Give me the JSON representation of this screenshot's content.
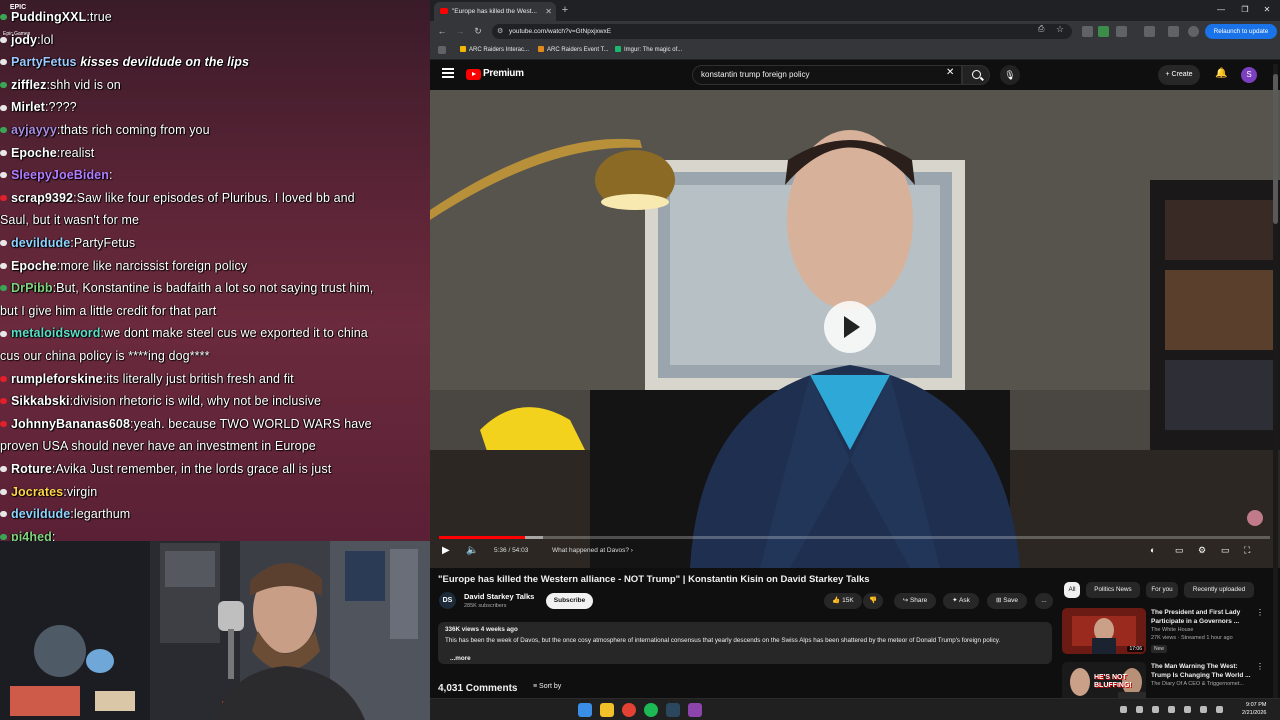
{
  "overlay": {
    "epic_label": "EPIC",
    "epic_sub": "Epic Games",
    "chat": [
      {
        "user": "PuddingXXL",
        "message": "true",
        "color": "#ffffff",
        "badge": "#3aa655",
        "italic": false
      },
      {
        "user": "jody",
        "message": "lol",
        "color": "#ffffff",
        "badge": "#e8e8e8",
        "italic": false
      },
      {
        "user": "PartyFetus",
        "message": "kisses devildude on the lips",
        "color": "#9ec9ff",
        "badge": "#e8e8e8",
        "italic": true
      },
      {
        "user": "zifflez",
        "message": "shh vid is on",
        "color": "#ffffff",
        "badge": "#3aa655",
        "italic": false
      },
      {
        "user": "Mirlet",
        "message": "????",
        "color": "#ffffff",
        "badge": "#e8e8e8",
        "italic": false
      },
      {
        "user": "ayjayyy",
        "message": "thats rich coming from you",
        "color": "#a98ce0",
        "badge": "#3aa655",
        "italic": false
      },
      {
        "user": "Epoche",
        "message": "realist",
        "color": "#ffffff",
        "badge": "#e8e8e8",
        "italic": false
      },
      {
        "user": "SleepyJoeBiden",
        "message": "",
        "color": "#b57cff",
        "badge": "#e8e8e8",
        "italic": false
      },
      {
        "user": "scrap9392",
        "message": "Saw like four episodes of Pluribus. I loved bb and",
        "color": "#ffffff",
        "badge": "#e0202a",
        "italic": false
      },
      {
        "user": "",
        "message": "Saul, but it wasn't for me",
        "color": "#ffffff",
        "badge": "",
        "italic": false
      },
      {
        "user": "devildude",
        "message": "PartyFetus",
        "color": "#8fd3ff",
        "badge": "#e8e8e8",
        "italic": false
      },
      {
        "user": "Epoche",
        "message": "more like narcissist foreign policy",
        "color": "#ffffff",
        "badge": "#e8e8e8",
        "italic": false
      },
      {
        "user": "DrPibb",
        "message": "But, Konstantine is badfaith a lot so not saying trust him,",
        "color": "#7fd37f",
        "badge": "#3aa655",
        "italic": false
      },
      {
        "user": "",
        "message": "but I give him a little credit for that part",
        "color": "#ffffff",
        "badge": "",
        "italic": false
      },
      {
        "user": "metaloidsword",
        "message": "we dont make steel cus we exported it to china",
        "color": "#5ae0c8",
        "badge": "#e8e8e8",
        "italic": false
      },
      {
        "user": "",
        "message": "cus our china policy is ****ing dog****",
        "color": "#ffffff",
        "badge": "",
        "italic": false
      },
      {
        "user": "rumpleforskine",
        "message": "its literally just british fresh and fit",
        "color": "#ffffff",
        "badge": "#e0202a",
        "italic": false
      },
      {
        "user": "Sikkabski",
        "message": "division rhetoric is wild, why not be inclusive",
        "color": "#ffffff",
        "badge": "#e0202a",
        "italic": false
      },
      {
        "user": "JohnnyBananas608",
        "message": "yeah. because TWO WORLD WARS have",
        "color": "#ffffff",
        "badge": "#e0202a",
        "italic": false
      },
      {
        "user": "",
        "message": "proven USA should never have an investment in Europe",
        "color": "#ffffff",
        "badge": "",
        "italic": false
      },
      {
        "user": "Roture",
        "message": "Avika Just remember, in the lords grace all is just",
        "color": "#ffffff",
        "badge": "#e8e8e8",
        "italic": false
      },
      {
        "user": "Jocrates",
        "message": "virgin",
        "color": "#ffd54a",
        "badge": "#e8e8e8",
        "italic": false
      },
      {
        "user": "devildude",
        "message": "legarthum",
        "color": "#8fd3ff",
        "badge": "#e8e8e8",
        "italic": false
      },
      {
        "user": "pj4hed",
        "message": "",
        "color": "#7fd37f",
        "badge": "#3aa655",
        "italic": false
      }
    ]
  },
  "browser": {
    "tab_title": "\"Europe has killed the West...",
    "url": "youtube.com/watch?v=GtNpxjxwxE",
    "relaunch_label": "Relaunch to update",
    "bookmarks": [
      "ARC Raiders Interac...",
      "ARC Raiders Event T...",
      "Imgur: The magic of..."
    ]
  },
  "youtube": {
    "brand": "Premium",
    "search_query": "konstantin trump foreign policy",
    "create_label": "Create",
    "avatar_letter": "S",
    "player": {
      "time": "5:36 / 54:03",
      "chapter": "What happened at Davos?",
      "progress_fraction": 0.104,
      "buffer_fraction": 0.125
    },
    "video_title": "\"Europe has killed the Western alliance - NOT Trump\" | Konstantin Kisin on David Starkey Talks",
    "channel": {
      "logo_text": "DS",
      "name": "David Starkey Talks",
      "subscribers": "285K subscribers",
      "subscribe_label": "Subscribe"
    },
    "actions": {
      "likes": "15K",
      "share": "Share",
      "ask": "Ask",
      "save": "Save",
      "more": "..."
    },
    "description": {
      "meta": "336K views  4 weeks ago",
      "text": "This has been the week of Davos, but the once cosy atmosphere of international consensus that yearly descends on the Swiss Alps has been shattered by the meteor of Donald Trump's foreign policy.",
      "more": "...more"
    },
    "comments_count": "4,031 Comments",
    "sort_label": "Sort by",
    "chips": [
      "All",
      "Politics News",
      "For you",
      "Recently uploaded"
    ],
    "recommendations": [
      {
        "title": "The President and First Lady Participate in a Governors ...",
        "channel": "The White House",
        "meta": "27K views · Streamed 1 hour ago",
        "badge": "New",
        "duration": "17:06"
      },
      {
        "title": "The Man Warning The West: Trump Is Changing The World ...",
        "channel": "The Diary Of A CEO",
        "meta": "& Triggernomet...",
        "badge": "",
        "duration": "",
        "thumb_text": "HE'S NOT BLUFFING!"
      }
    ]
  },
  "taskbar": {
    "time": "9:07 PM",
    "date": "2/21/2026"
  }
}
